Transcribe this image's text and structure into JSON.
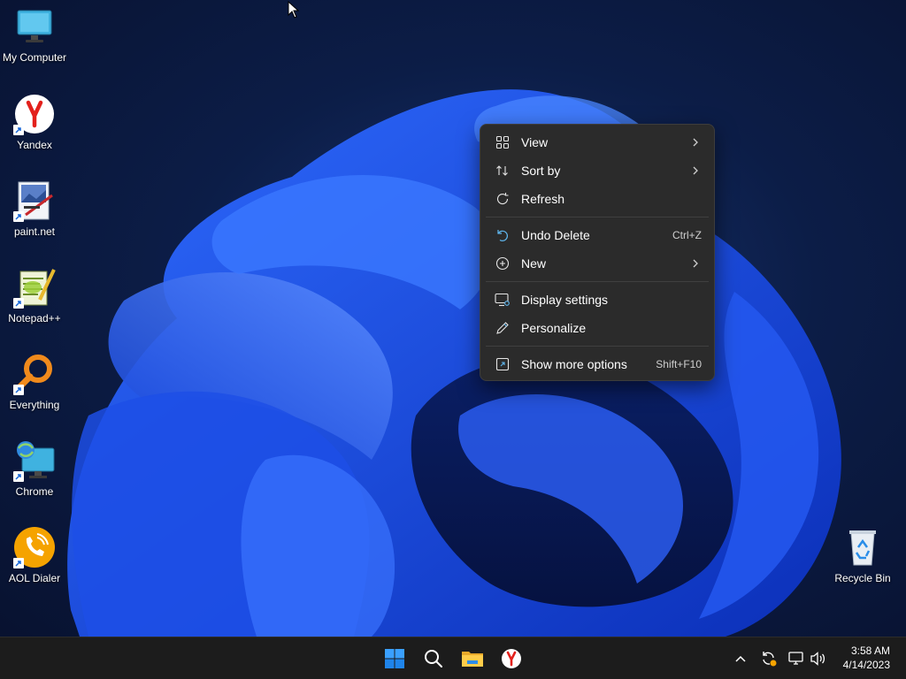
{
  "desktop": {
    "icons": [
      {
        "label": "My Computer",
        "icon": "monitor-icon"
      },
      {
        "label": "Yandex",
        "icon": "yandex-browser-icon"
      },
      {
        "label": "paint.net",
        "icon": "paint-net-icon"
      },
      {
        "label": "Notepad++",
        "icon": "notepad-plus-plus-icon"
      },
      {
        "label": "Everything",
        "icon": "everything-search-icon"
      },
      {
        "label": "Chrome",
        "icon": "chrome-shortcut-icon"
      },
      {
        "label": "AOL Dialer",
        "icon": "aol-dialer-icon"
      }
    ],
    "recycle_bin": {
      "label": "Recycle Bin",
      "icon": "recycle-bin-icon"
    }
  },
  "context_menu": {
    "items": [
      {
        "label": "View",
        "icon": "view-grid-icon",
        "submenu": true
      },
      {
        "label": "Sort by",
        "icon": "sort-icon",
        "submenu": true
      },
      {
        "label": "Refresh",
        "icon": "refresh-icon"
      },
      {
        "label": "Undo Delete",
        "icon": "undo-icon",
        "shortcut": "Ctrl+Z"
      },
      {
        "label": "New",
        "icon": "new-plus-icon",
        "submenu": true
      },
      {
        "label": "Display settings",
        "icon": "display-settings-icon"
      },
      {
        "label": "Personalize",
        "icon": "pen-icon"
      },
      {
        "label": "Show more options",
        "icon": "show-more-options-icon",
        "shortcut": "Shift+F10"
      }
    ]
  },
  "taskbar": {
    "pinned": [
      "start-button",
      "search-button",
      "file-explorer-button",
      "yandex-taskbar-button"
    ],
    "tray": [
      "show-hidden-icons",
      "update-icon",
      "network-icon",
      "volume-icon"
    ],
    "clock": {
      "time": "3:58 AM",
      "date": "4/14/2023"
    }
  },
  "colors": {
    "accent_blue": "#1e5bff",
    "menu_bg": "#2b2b2b",
    "taskbar_bg": "#1c1c1c"
  }
}
